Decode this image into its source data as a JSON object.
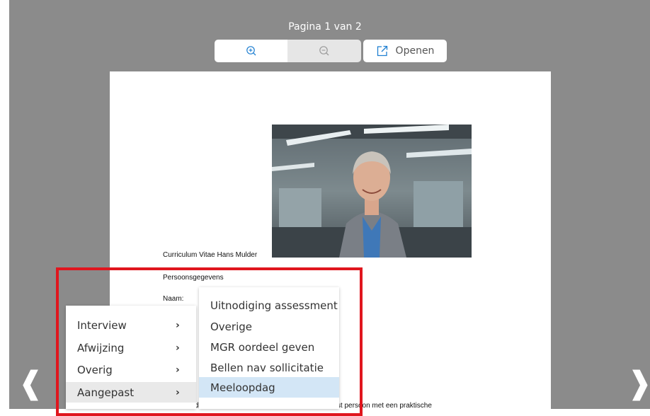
{
  "viewer": {
    "page_indicator": "Pagina 1 van 2",
    "open_label": "Openen",
    "prev_arrow": "❰",
    "next_arrow": "❱"
  },
  "document": {
    "cv_title": "Curriculum Vitae Hans Mulder",
    "section_personal": "Persoonsgegevens",
    "name_label": "Naam:",
    "intro_line": "da's kennen me als een creatief en enthousiast persoon met een praktische"
  },
  "context_menu": {
    "items": [
      {
        "label": "Interview",
        "chevron": "›"
      },
      {
        "label": "Afwijzing",
        "chevron": "›"
      },
      {
        "label": "Overig",
        "chevron": "›"
      },
      {
        "label": "Aangepast",
        "chevron": "›"
      }
    ]
  },
  "submenu": {
    "items": [
      {
        "label": "Uitnodiging assessment"
      },
      {
        "label": "Overige"
      },
      {
        "label": "MGR oordeel geven"
      },
      {
        "label": "Bellen nav sollicitatie"
      },
      {
        "label": "Meeloopdag"
      }
    ],
    "selected": "Meeloopdag"
  },
  "colors": {
    "viewer_bg": "#8b8b8b",
    "highlight": "#e0161e",
    "selected_bg": "#d3e6f6",
    "icon_blue": "#1f7fd1"
  },
  "icons": {
    "zoom_in": "zoom-in-icon",
    "zoom_out": "zoom-out-icon",
    "open": "external-link-icon"
  }
}
